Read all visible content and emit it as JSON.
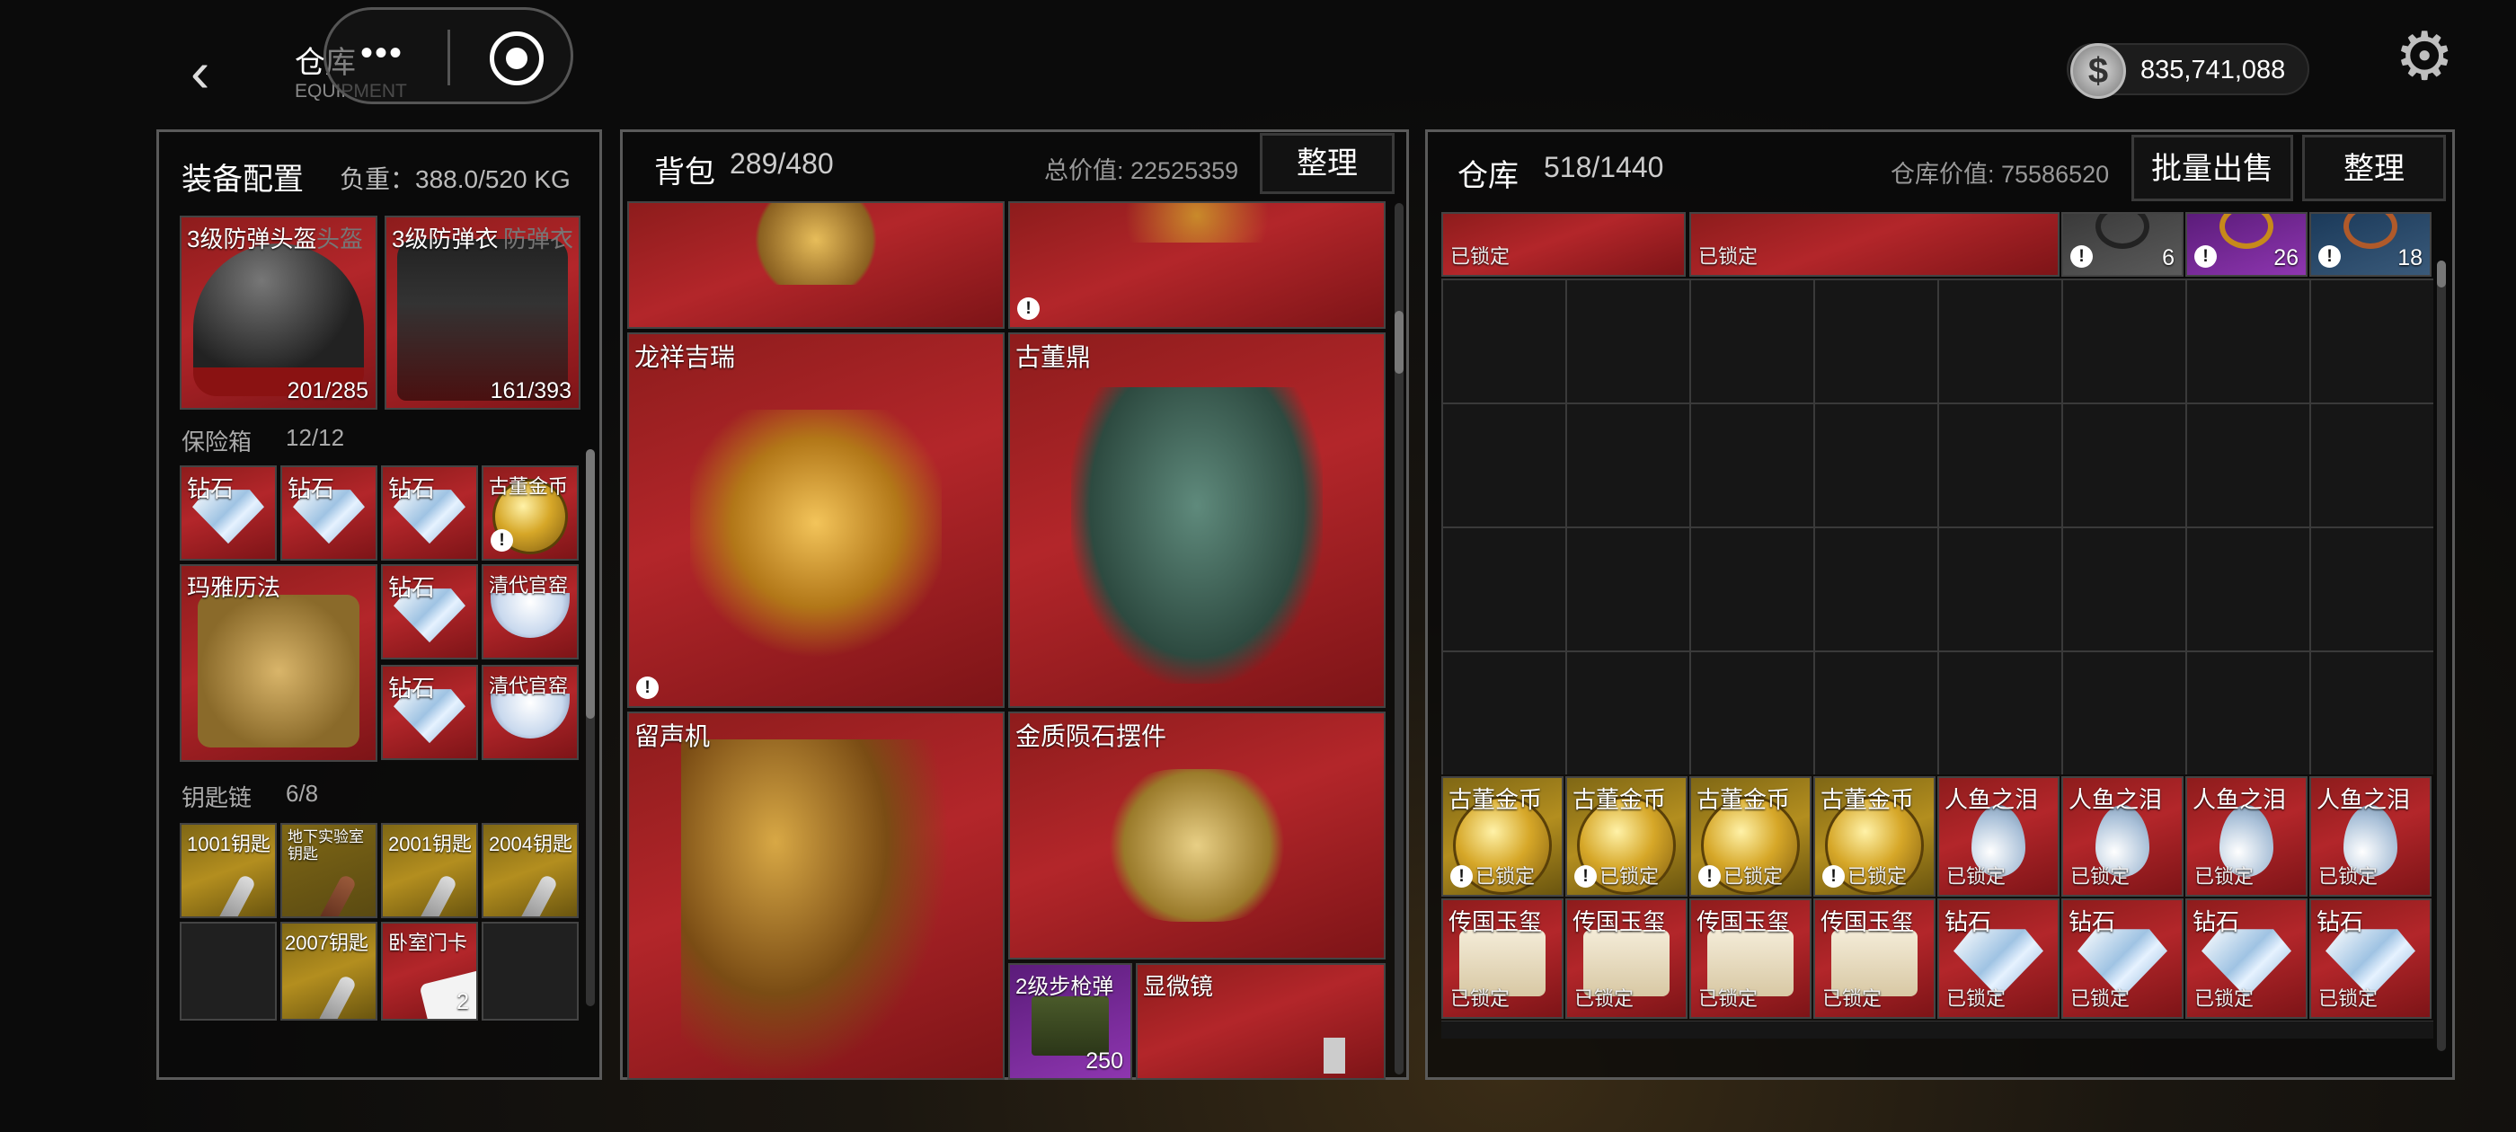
{
  "header": {
    "back": "‹",
    "title": "仓库",
    "subtitle": "EQUIPMENT",
    "dots": "•••",
    "currency": "835,741,088"
  },
  "equip_panel": {
    "title": "装备配置",
    "weight": "负重：388.0/520 KG"
  },
  "armor": [
    {
      "label": "3级防弹头盔",
      "ghost": "头盔",
      "count": "201/285"
    },
    {
      "label": "3级防弹衣",
      "ghost": "防弹衣",
      "count": "161/393"
    }
  ],
  "safe": {
    "title": "保险箱",
    "count": "12/12",
    "items": [
      {
        "label": "钻石",
        "art": "diamond"
      },
      {
        "label": "钻石",
        "art": "diamond"
      },
      {
        "label": "钻石",
        "art": "diamond"
      },
      {
        "label": "古董金币",
        "art": "coin",
        "warn": "!"
      },
      {
        "label": "玛雅历法",
        "art": "maya"
      },
      {
        "label": "钻石",
        "art": "diamond"
      },
      {
        "label": "清代官窑",
        "art": "bowl"
      },
      {
        "label": "钻石",
        "art": "diamond"
      },
      {
        "label": "清代官窑",
        "art": "bowl"
      }
    ]
  },
  "keychain": {
    "title": "钥匙链",
    "count": "6/8",
    "items": [
      {
        "label": "1001钥匙"
      },
      {
        "label": "地下实验室钥匙"
      },
      {
        "label": "2001钥匙"
      },
      {
        "label": "2004钥匙"
      },
      {
        "label": "2007钥匙"
      },
      {
        "label": "卧室门卡",
        "count": "2"
      }
    ]
  },
  "backpack": {
    "title": "背包",
    "capacity": "289/480",
    "value": "总价值: 22525359",
    "sort": "整理",
    "items": [
      {
        "label": "",
        "warn": ""
      },
      {
        "label": "",
        "warn": "!"
      },
      {
        "label": "龙祥吉瑞",
        "warn": "!"
      },
      {
        "label": "古董鼎",
        "warn": ""
      },
      {
        "label": "留声机",
        "warn": ""
      },
      {
        "label": "金质陨石摆件",
        "warn": ""
      },
      {
        "label": "2级步枪弹",
        "count": "250"
      },
      {
        "label": "显微镜"
      }
    ]
  },
  "warehouse": {
    "title": "仓库",
    "capacity": "518/1440",
    "value": "仓库价值: 75586520",
    "bulk_sell": "批量出售",
    "sort": "整理",
    "top_row": [
      {
        "lock": "已锁定"
      },
      {
        "lock": "已锁定"
      },
      {
        "count": "6",
        "warn": "!"
      },
      {
        "count": "26",
        "warn": "!"
      },
      {
        "count": "18",
        "warn": "!"
      }
    ],
    "row_a": [
      {
        "label": "古董金币",
        "lock": "已锁定",
        "warn": "!"
      },
      {
        "label": "古董金币",
        "lock": "已锁定",
        "warn": "!"
      },
      {
        "label": "古董金币",
        "lock": "已锁定",
        "warn": "!"
      },
      {
        "label": "古董金币",
        "lock": "已锁定",
        "warn": "!"
      },
      {
        "label": "人鱼之泪",
        "lock": "已锁定"
      },
      {
        "label": "人鱼之泪",
        "lock": "已锁定"
      },
      {
        "label": "人鱼之泪",
        "lock": "已锁定"
      },
      {
        "label": "人鱼之泪",
        "lock": "已锁定"
      }
    ],
    "row_b": [
      {
        "label": "传国玉玺",
        "lock": "已锁定"
      },
      {
        "label": "传国玉玺",
        "lock": "已锁定"
      },
      {
        "label": "传国玉玺",
        "lock": "已锁定"
      },
      {
        "label": "传国玉玺",
        "lock": "已锁定"
      },
      {
        "label": "钻石",
        "lock": "已锁定"
      },
      {
        "label": "钻石",
        "lock": "已锁定"
      },
      {
        "label": "钻石",
        "lock": "已锁定"
      },
      {
        "label": "钻石",
        "lock": "已锁定"
      }
    ]
  }
}
